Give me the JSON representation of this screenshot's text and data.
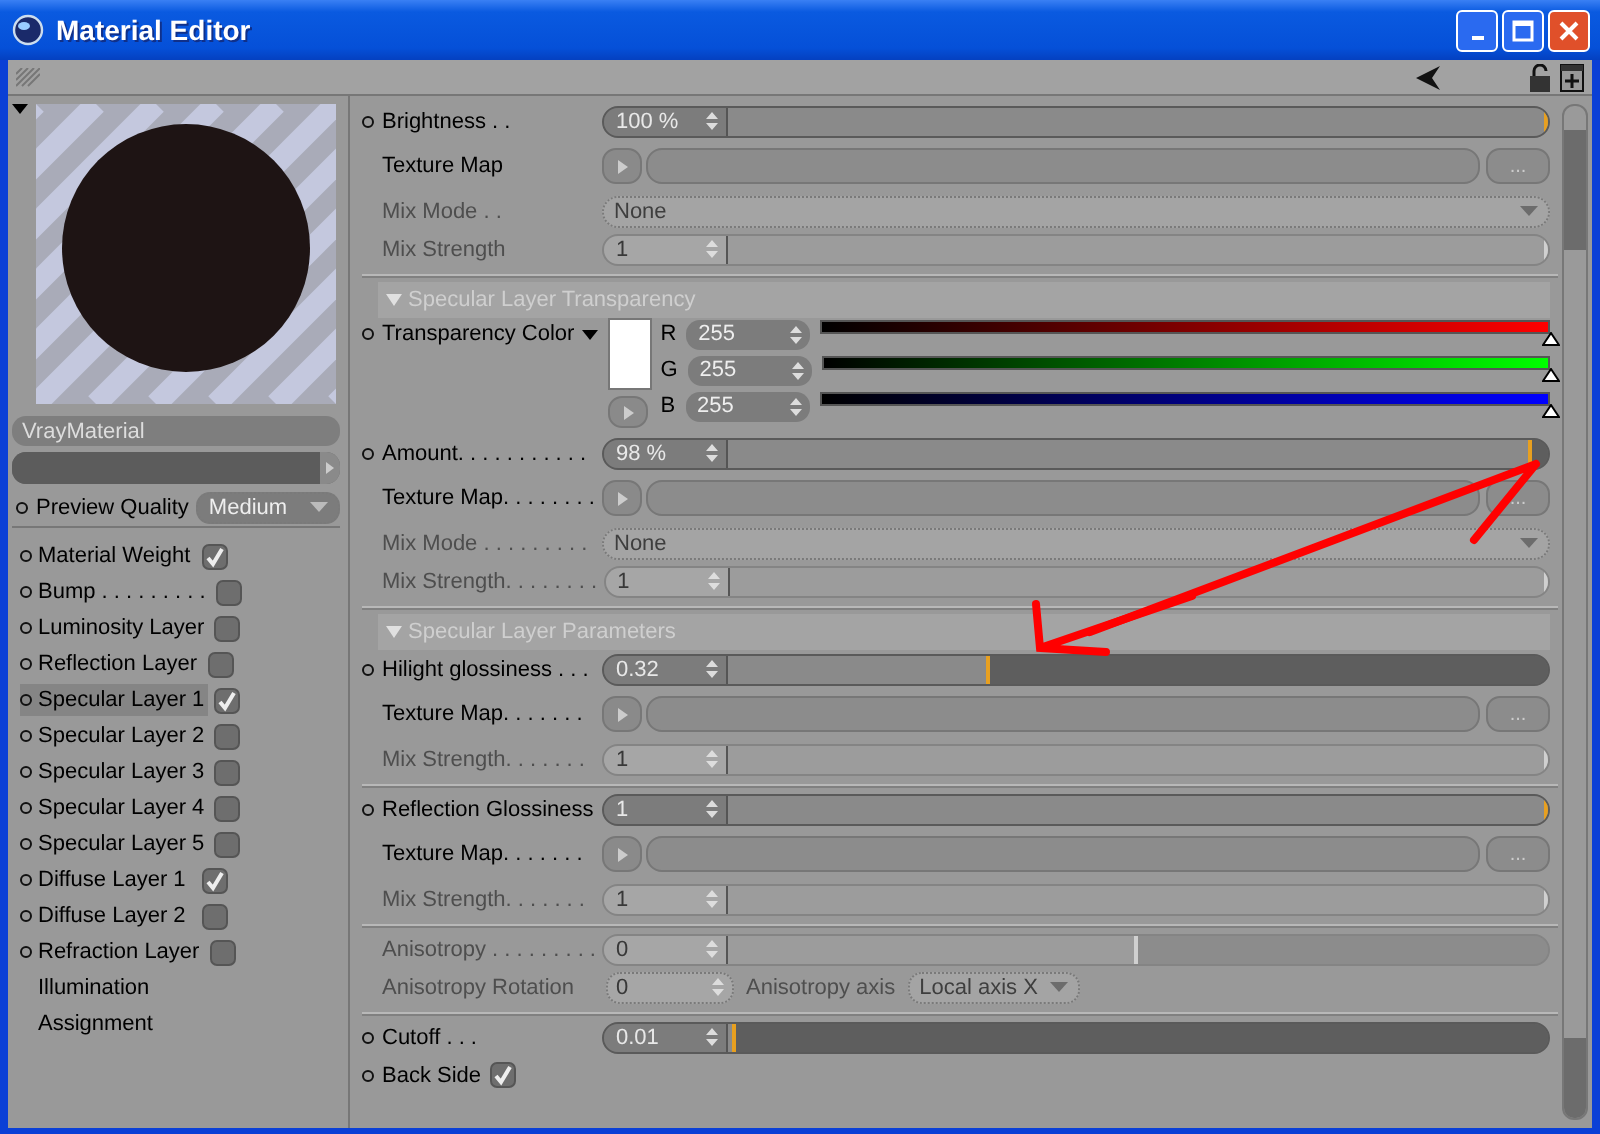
{
  "window": {
    "title": "Material Editor"
  },
  "preview": {
    "material_name": "VrayMaterial",
    "quality_label": "Preview Quality",
    "quality": "Medium",
    "level": 1
  },
  "channels": [
    {
      "kind": "toggle",
      "name": "Material Weight",
      "checked": true,
      "selected": false
    },
    {
      "kind": "toggle",
      "name": "Bump . . . . . . . . .",
      "checked": false,
      "selected": false
    },
    {
      "kind": "toggle",
      "name": "Luminosity Layer",
      "checked": false,
      "selected": false
    },
    {
      "kind": "toggle",
      "name": "Reflection Layer",
      "checked": false,
      "selected": false
    },
    {
      "kind": "toggle",
      "name": "Specular Layer 1",
      "checked": true,
      "selected": true
    },
    {
      "kind": "toggle",
      "name": "Specular Layer 2",
      "checked": false,
      "selected": false
    },
    {
      "kind": "toggle",
      "name": "Specular Layer 3",
      "checked": false,
      "selected": false
    },
    {
      "kind": "toggle",
      "name": "Specular Layer 4",
      "checked": false,
      "selected": false
    },
    {
      "kind": "toggle",
      "name": "Specular Layer 5",
      "checked": false,
      "selected": false
    },
    {
      "kind": "toggle",
      "name": "Diffuse Layer 1",
      "checked": true,
      "selected": false
    },
    {
      "kind": "toggle",
      "name": "Diffuse Layer 2",
      "checked": false,
      "selected": false
    },
    {
      "kind": "toggle",
      "name": "Refraction Layer",
      "checked": false,
      "selected": false
    },
    {
      "kind": "page",
      "name": "Illumination",
      "selected": false
    },
    {
      "kind": "page",
      "name": "Assignment",
      "selected": false
    }
  ],
  "groups": [
    {
      "rows": [
        {
          "kind": "slider",
          "label": "Brightness . .",
          "value": "100 %",
          "level": 1,
          "disabled": false
        },
        {
          "kind": "texture",
          "label": "Texture Map",
          "button": "..."
        },
        {
          "kind": "dropdown",
          "label": "Mix Mode . .",
          "value": "None",
          "disabled": true
        },
        {
          "kind": "slider",
          "label": "Mix Strength",
          "value": "1",
          "level": 1,
          "disabled": true
        }
      ]
    },
    {
      "rows": [
        {
          "kind": "header",
          "label": "Specular Layer Transparency",
          "expanded": true
        },
        {
          "kind": "color",
          "label": "Transparency Color",
          "channels": [
            {
              "name": "R",
              "value": "255",
              "level": 1
            },
            {
              "name": "G",
              "value": "255",
              "level": 1
            },
            {
              "name": "B",
              "value": "255",
              "level": 1
            }
          ]
        },
        {
          "kind": "slider",
          "label": "Amount. . . . . . . . . . .",
          "value": "98 %",
          "level": 0.98,
          "disabled": false
        },
        {
          "kind": "texture",
          "label": "Texture Map. . . . . . . .",
          "button": "..."
        },
        {
          "kind": "dropdown",
          "label": "Mix Mode . . . . . . . . .",
          "value": "None",
          "disabled": true
        },
        {
          "kind": "slider",
          "label": "Mix Strength. . . . . . . .",
          "value": "1",
          "level": 1,
          "disabled": true
        }
      ]
    },
    {
      "rows": [
        {
          "kind": "header",
          "label": "Specular Layer Parameters",
          "expanded": true
        },
        {
          "kind": "slider",
          "label": "Hilight glossiness . . .",
          "value": "0.32",
          "level": 0.32,
          "disabled": false
        },
        {
          "kind": "texture",
          "label": "Texture Map. . . . . . .",
          "button": "..."
        },
        {
          "kind": "slider",
          "label": "Mix Strength. . . . . . .",
          "value": "1",
          "level": 1,
          "disabled": true
        }
      ]
    },
    {
      "rows": [
        {
          "kind": "slider",
          "label": "Reflection Glossiness",
          "value": "1",
          "level": 1,
          "disabled": false
        },
        {
          "kind": "texture",
          "label": "Texture Map. . . . . . .",
          "button": "..."
        },
        {
          "kind": "slider",
          "label": "Mix Strength. . . . . . .",
          "value": "1",
          "level": 1,
          "disabled": true
        }
      ]
    },
    {
      "rows": [
        {
          "kind": "slider",
          "label": "Anisotropy . . . . . . . . .",
          "value": "0",
          "level": 0.5,
          "disabled": true
        },
        {
          "kind": "pair",
          "label": "Anisotropy Rotation",
          "value": "0",
          "label_2": "Anisotropy axis",
          "value_2": "Local axis X",
          "disabled": true
        }
      ]
    },
    {
      "rows": [
        {
          "kind": "slider",
          "label": "Cutoff . . .",
          "value": "0.01",
          "level": 0.01,
          "disabled": false
        },
        {
          "kind": "check",
          "label": "Back Side",
          "checked": true
        }
      ]
    }
  ]
}
